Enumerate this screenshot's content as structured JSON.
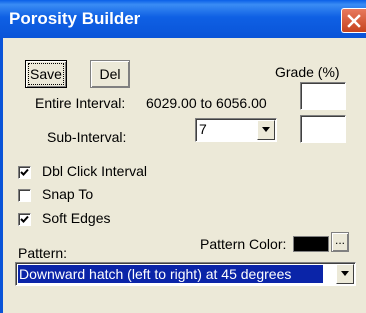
{
  "window": {
    "title": "Porosity Builder"
  },
  "buttons": {
    "save": "Save",
    "del": "Del",
    "ellipsis": "..."
  },
  "grade": {
    "label": "Grade (%)",
    "value": ""
  },
  "entire_interval": {
    "label": "Entire Interval:",
    "value": "6029.00 to 6056.00"
  },
  "sub_interval": {
    "label": "Sub-Interval:",
    "selected": "7",
    "grade_value": ""
  },
  "checkboxes": [
    {
      "label": "Dbl Click Interval",
      "checked": true
    },
    {
      "label": "Snap To",
      "checked": false
    },
    {
      "label": "Soft Edges",
      "checked": true
    }
  ],
  "pattern": {
    "label": "Pattern:",
    "selected": "Downward hatch (left to right) at 45 degrees",
    "selected_bg": "#0a24a8"
  },
  "pattern_color": {
    "label": "Pattern Color:",
    "swatch": "#000000"
  },
  "icons": {
    "close": "close-icon",
    "dropdown": "chevron-down-icon",
    "check": "check-icon"
  }
}
